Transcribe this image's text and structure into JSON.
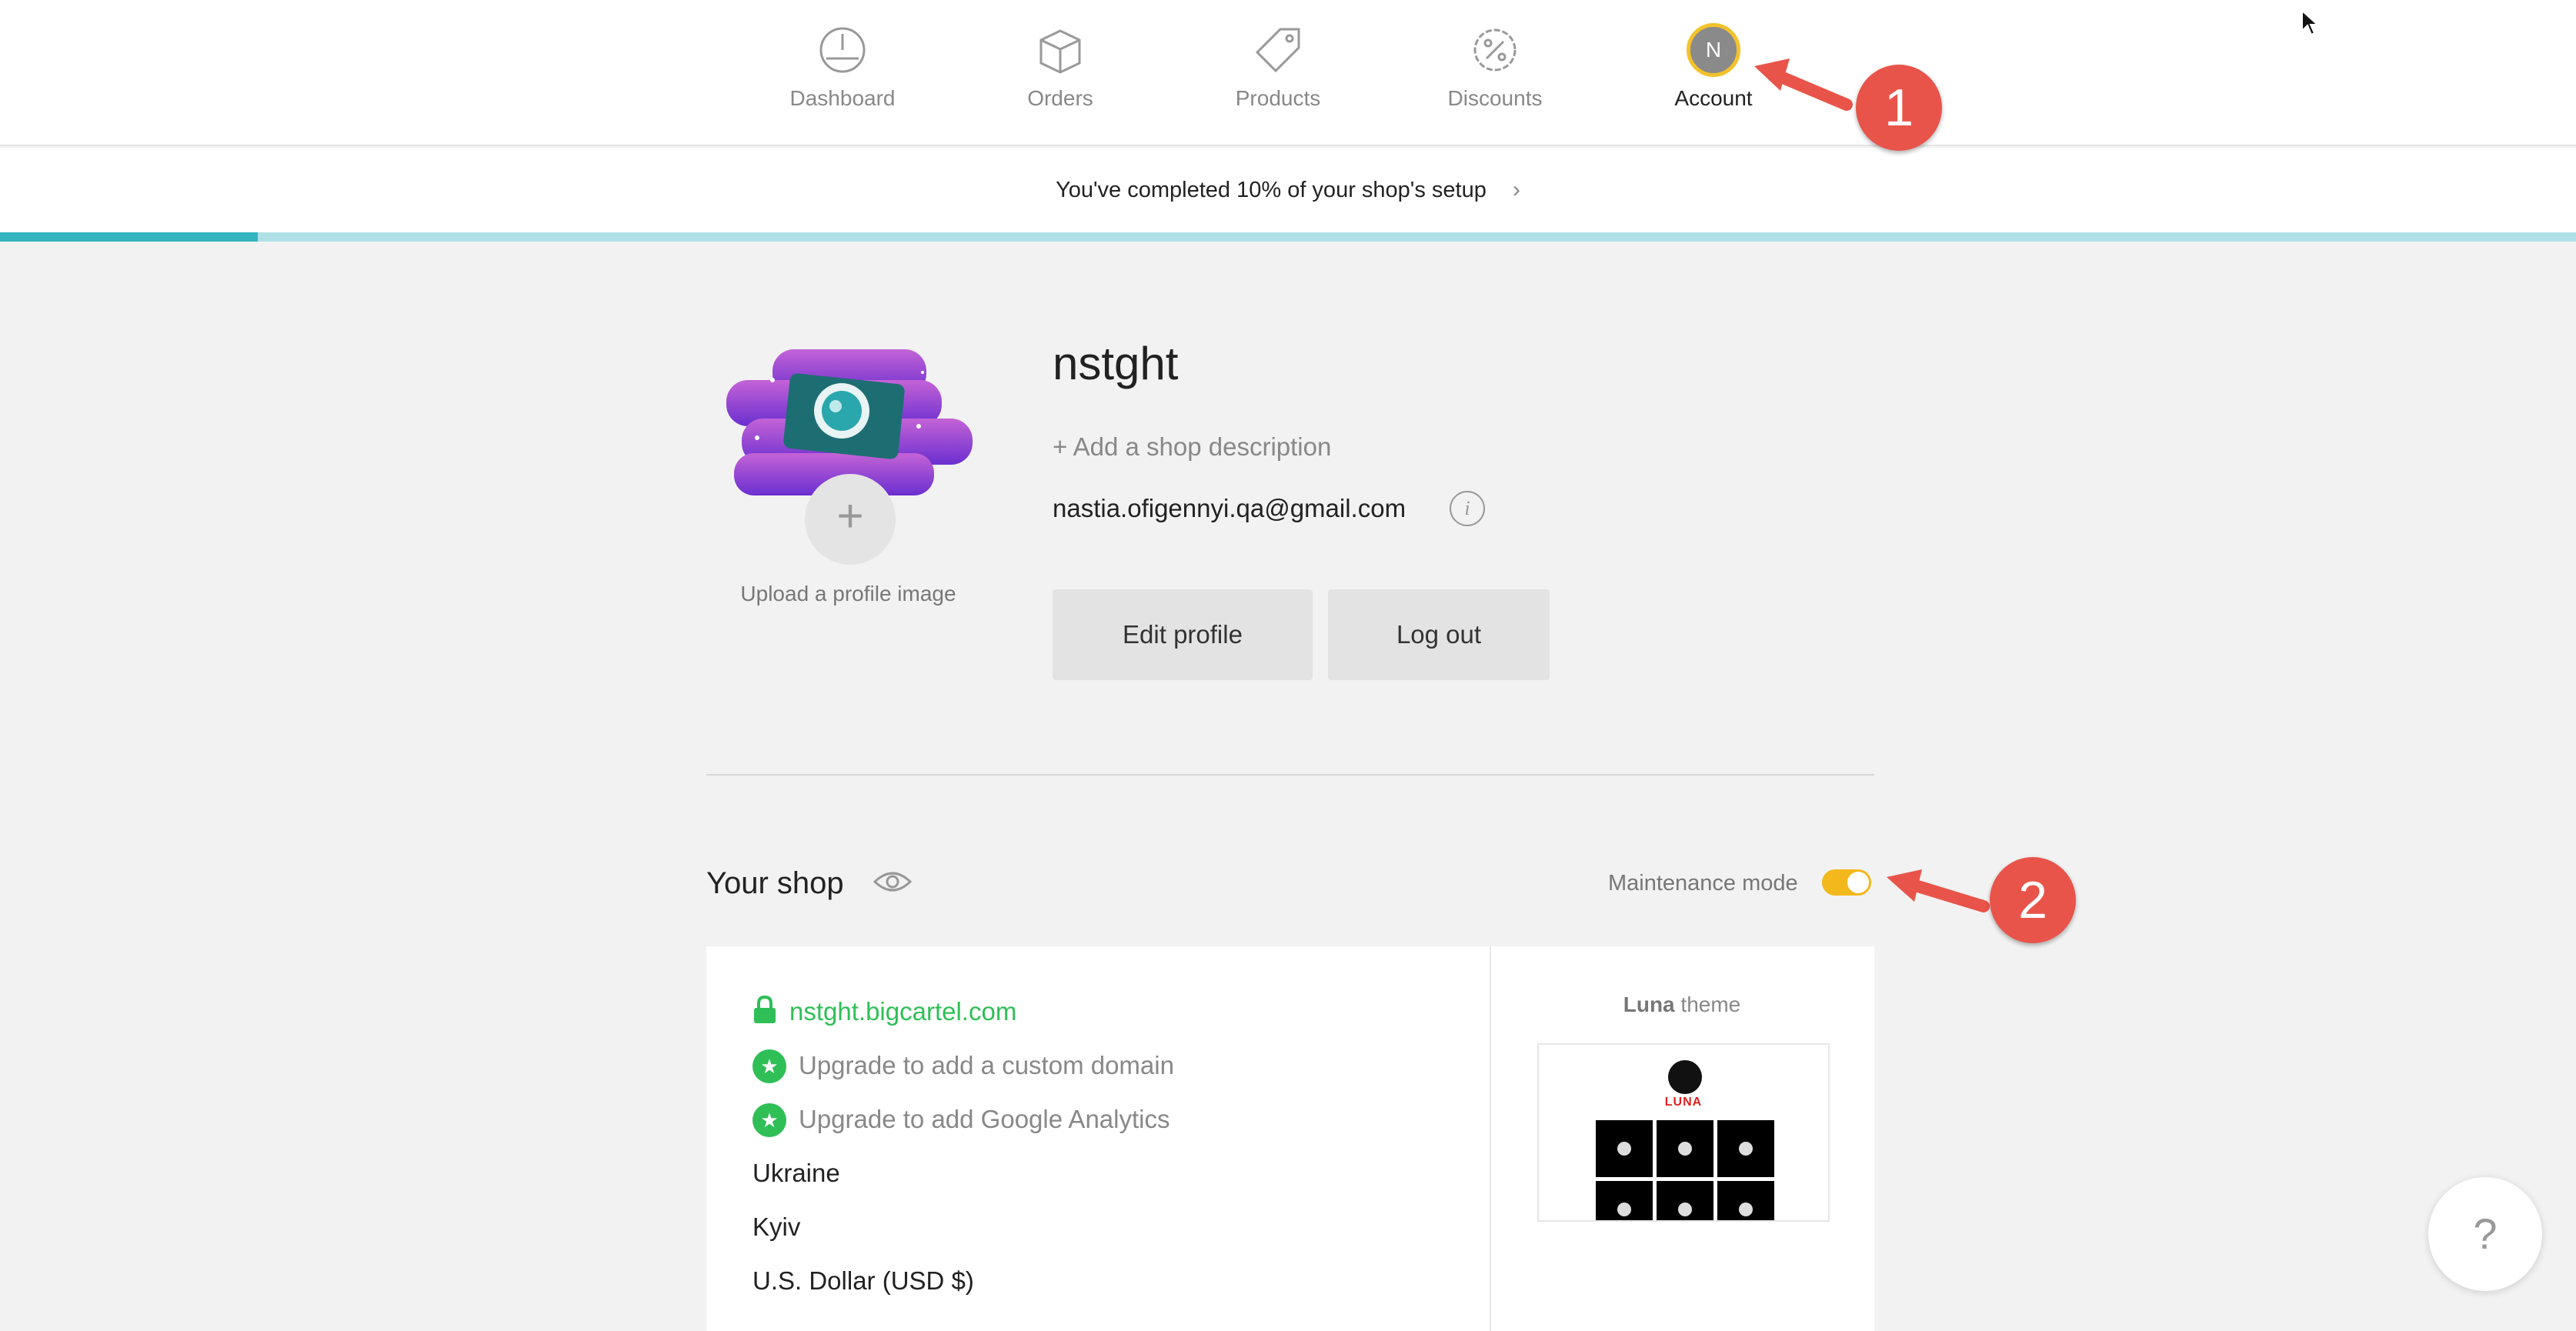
{
  "nav": {
    "items": [
      {
        "label": "Dashboard",
        "icon": "dashboard-gauge-icon"
      },
      {
        "label": "Orders",
        "icon": "orders-box-icon"
      },
      {
        "label": "Products",
        "icon": "products-tag-icon"
      },
      {
        "label": "Discounts",
        "icon": "discounts-percent-icon"
      },
      {
        "label": "Account",
        "icon": "account-avatar",
        "avatar_initial": "N",
        "active": true
      }
    ]
  },
  "setup": {
    "text": "You've completed 10% of your shop's setup",
    "progress_fraction": 0.1,
    "chevron": "›"
  },
  "profile": {
    "upload_label": "Upload a profile image",
    "upload_symbol": "+",
    "shop_name": "nstght",
    "description_link": "+ Add a shop description",
    "email": "nastia.ofigennyi.qa@gmail.com",
    "info_symbol": "i",
    "edit_button": "Edit profile",
    "logout_button": "Log out"
  },
  "your_shop": {
    "title": "Your shop",
    "maintenance_label": "Maintenance mode",
    "maintenance_on": true,
    "url": "nstght.bigcartel.com",
    "upgrade_domain": "Upgrade to add a custom domain",
    "upgrade_analytics": "Upgrade to add Google Analytics",
    "country": "Ukraine",
    "city": "Kyiv",
    "currency": "U.S. Dollar (USD $)",
    "theme_name": "Luna",
    "theme_suffix": " theme",
    "theme_thumb_text": "LUNA"
  },
  "help": {
    "symbol": "?"
  },
  "annotations": {
    "badge_1": "1",
    "badge_2": "2"
  },
  "colors": {
    "accent_teal": "#33b4bf",
    "toggle_yellow": "#f3b81c",
    "link_green": "#2fbf56",
    "badge_red": "#e9544a"
  }
}
